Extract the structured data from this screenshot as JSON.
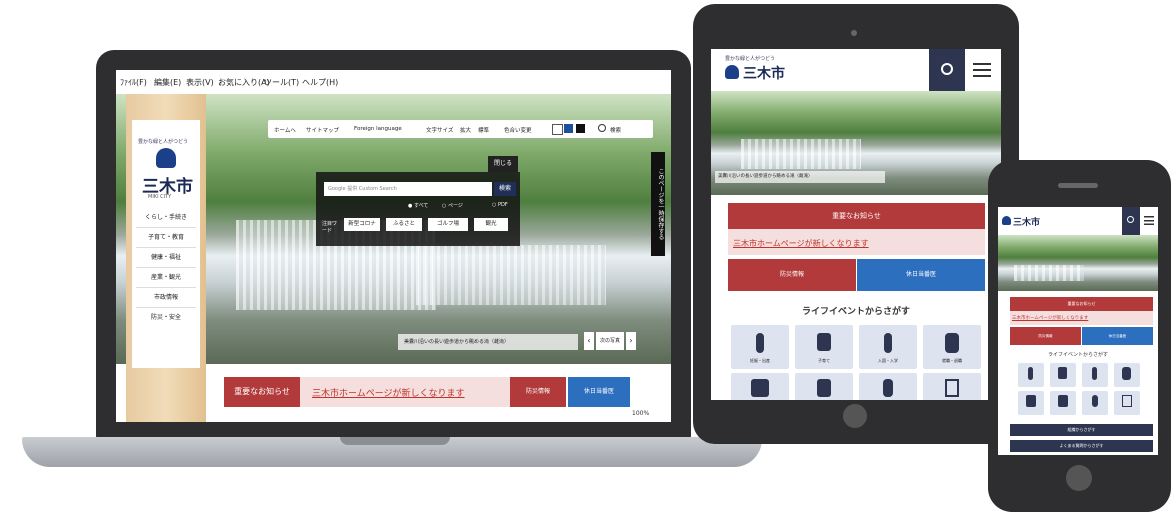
{
  "laptop": {
    "menubar": [
      "ﾌｧｲﾙ(F)",
      "編集(E)",
      "表示(V)",
      "お気に入り(A)",
      "ツール(T)",
      "ヘルプ(H)"
    ],
    "toolbar": [
      "ホームへ",
      "サイトマップ",
      "Foreign language",
      "文字サイズ",
      "拡大",
      "標準",
      "色合い変更",
      "検索"
    ],
    "logo_tagline": "豊かな緑と人がつどう",
    "logo_title": "三木市",
    "logo_sub": "MIKI CITY",
    "sidenav": [
      "くらし・手続き",
      "子育て・教育",
      "健康・福祉",
      "産業・観光",
      "市政情報",
      "防災・安全"
    ],
    "close_label": "閉じる",
    "search_placeholder": "Google 提供 Custom Search",
    "search_button": "検索",
    "radio_options": [
      "すべて",
      "ページ",
      "PDF"
    ],
    "keyword_label": "注目ワード",
    "keywords": [
      "新型コロナ",
      "ふるさと",
      "ゴルフ場",
      "観光"
    ],
    "side_strip": "このページを一時保存する",
    "caption": "美嚢川沿いの長い遊歩道から眺める滝（雌滝）",
    "nav_next": "次の写真",
    "notice_label": "重要なお知らせ",
    "notice_link": "三木市ホームページが新しくなります",
    "btn_red": "防災情報",
    "btn_blue": "休日当番医",
    "zoom": "100%"
  },
  "tablet": {
    "logo_tagline": "豊かな緑と人がつどう",
    "logo_title": "三木市",
    "caption": "美嚢川沿いの長い遊歩道から眺める滝（雌滝）",
    "notice_label": "重要なお知らせ",
    "notice_link": "三木市ホームページが新しくなります",
    "btn_red": "防災情報",
    "btn_blue": "休日当番医",
    "section_title": "ライフイベントからさがす",
    "events": [
      "妊娠・出産",
      "子育て",
      "入園・入学",
      "就職・退職"
    ]
  },
  "phone": {
    "logo_title": "三木市",
    "notice_label": "重要なお知らせ",
    "notice_link": "三木市ホームページが新しくなります",
    "btn_red": "防災情報",
    "btn_blue": "休日当番医",
    "section_title": "ライフイベントからさがす",
    "footer_buttons": [
      "組織からさがす",
      "よくある質問からさがす"
    ]
  },
  "colors": {
    "accent_red": "#b23a3a",
    "accent_blue": "#2d6fbf",
    "navy": "#2d3550"
  }
}
